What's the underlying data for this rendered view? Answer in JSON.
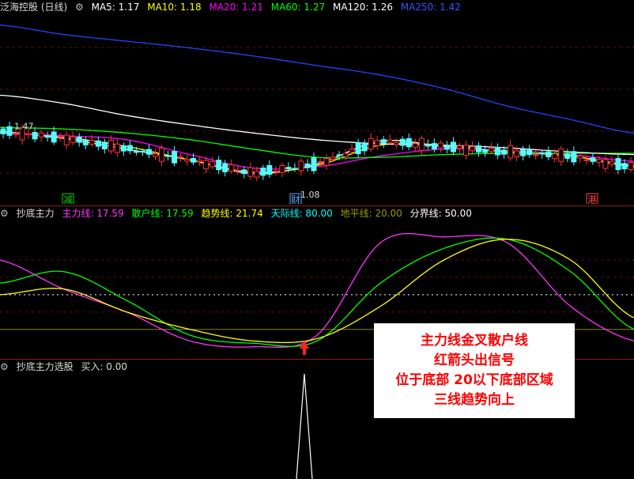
{
  "main": {
    "title": "泛海控股 (日线)",
    "ma": [
      {
        "label": "MA5: 1.17",
        "color": "#ffffff"
      },
      {
        "label": "MA10: 1.18",
        "color": "#ffff00"
      },
      {
        "label": "MA20: 1.21",
        "color": "#ff00ff"
      },
      {
        "label": "MA60: 1.27",
        "color": "#00ff00"
      },
      {
        "label": "MA120: 1.26",
        "color": "#ffffff"
      },
      {
        "label": "MA250: 1.42",
        "color": "#3355ff"
      }
    ],
    "hi_label": "1.47",
    "lo_label": "1.08",
    "markers": [
      {
        "text": "减",
        "color": "#00dd00"
      },
      {
        "text": "财",
        "color": "#66aaff"
      },
      {
        "text": "港",
        "color": "#ff4444"
      }
    ]
  },
  "ind": {
    "title": "抄底主力",
    "values": [
      {
        "label": "主力线: 17.59",
        "color": "#ff33ff"
      },
      {
        "label": "散户线: 17.59",
        "color": "#00ff00"
      },
      {
        "label": "趋势线: 21.74",
        "color": "#ffff00"
      },
      {
        "label": "天际线: 80.00",
        "color": "#00ffff"
      },
      {
        "label": "地平线: 20.00",
        "color": "#999900"
      },
      {
        "label": "分界线: 50.00",
        "color": "#ffffff"
      }
    ]
  },
  "note": {
    "lines": [
      "主力线金叉散户线",
      "红箭头出信号",
      "位于底部 20以下底部区域",
      "三线趋势向上"
    ]
  },
  "sel": {
    "title": "抄底主力选股",
    "value_label": "买入: 0.00"
  },
  "chart_data": [
    {
      "type": "line",
      "title": "泛海控股 (日线)",
      "x": [
        0,
        10,
        20,
        30,
        40,
        50,
        60,
        70,
        80,
        90,
        100
      ],
      "series": [
        {
          "name": "MA5",
          "values": [
            1.43,
            1.38,
            1.3,
            1.22,
            1.12,
            1.19,
            1.36,
            1.32,
            1.28,
            1.25,
            1.17
          ]
        },
        {
          "name": "MA10",
          "values": [
            1.42,
            1.39,
            1.32,
            1.22,
            1.13,
            1.18,
            1.33,
            1.33,
            1.28,
            1.25,
            1.18
          ]
        },
        {
          "name": "MA20",
          "values": [
            1.42,
            1.4,
            1.37,
            1.26,
            1.16,
            1.17,
            1.25,
            1.3,
            1.29,
            1.26,
            1.21
          ]
        },
        {
          "name": "MA60",
          "values": [
            1.46,
            1.45,
            1.42,
            1.37,
            1.3,
            1.24,
            1.24,
            1.26,
            1.27,
            1.27,
            1.27
          ]
        },
        {
          "name": "MA120",
          "values": [
            1.7,
            1.64,
            1.55,
            1.48,
            1.42,
            1.37,
            1.34,
            1.33,
            1.31,
            1.28,
            1.26
          ]
        },
        {
          "name": "MA250",
          "values": [
            2.22,
            2.15,
            2.1,
            2.05,
            1.99,
            1.92,
            1.85,
            1.75,
            1.62,
            1.52,
            1.42
          ]
        }
      ],
      "markers": {
        "high": 1.47,
        "low": 1.08
      }
    },
    {
      "type": "line",
      "title": "抄底主力",
      "x": [
        0,
        10,
        20,
        30,
        40,
        50,
        60,
        70,
        80,
        90,
        100
      ],
      "series": [
        {
          "name": "主力线",
          "values": [
            80,
            55,
            35,
            10,
            5,
            15,
            95,
            100,
            95,
            40,
            10
          ]
        },
        {
          "name": "散户线",
          "values": [
            60,
            70,
            45,
            15,
            8,
            10,
            60,
            90,
            98,
            70,
            20
          ]
        },
        {
          "name": "趋势线",
          "values": [
            50,
            55,
            35,
            20,
            10,
            12,
            40,
            80,
            98,
            80,
            30
          ]
        }
      ],
      "levels": {
        "天际线": 80,
        "地平线": 20,
        "分界线": 50
      },
      "ylim": [
        0,
        100
      ]
    },
    {
      "type": "line",
      "title": "抄底主力选股",
      "series": [
        {
          "name": "买入",
          "values": [
            0,
            1,
            0
          ]
        }
      ]
    }
  ]
}
